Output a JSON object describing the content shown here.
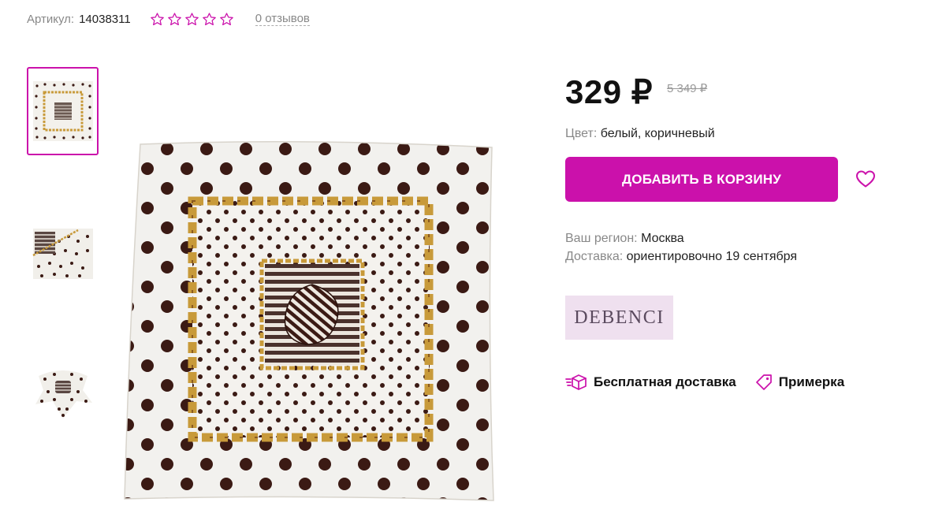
{
  "header": {
    "article_label": "Артикул:",
    "article_value": "14038311",
    "rating_stars": 0,
    "rating_max": 5,
    "reviews_link": "0 отзывов"
  },
  "gallery": {
    "thumbnails": [
      {
        "icon": "scarf-flat-thumbnail",
        "active": true
      },
      {
        "icon": "scarf-folded-thumbnail",
        "active": false
      },
      {
        "icon": "scarf-tied-thumbnail",
        "active": false
      }
    ],
    "main_image": "polka-dot-scarf-image"
  },
  "product": {
    "price": "329 ₽",
    "old_price": "5 349 ₽",
    "color_label": "Цвет:",
    "color_value": "белый, коричневый",
    "add_to_cart": "ДОБАВИТЬ В КОРЗИНУ",
    "favorite_icon": "heart-icon",
    "region_label": "Ваш регион:",
    "region_value": "Москва",
    "delivery_label": "Доставка:",
    "delivery_value": "ориентировочно 19 сентября",
    "brand": "DEBENCI"
  },
  "features": [
    {
      "icon": "delivery-box-icon",
      "label": "Бесплатная доставка"
    },
    {
      "icon": "tag-icon",
      "label": "Примерка"
    }
  ],
  "colors": {
    "accent": "#cb11ab",
    "brand_bg": "#efe0ef",
    "muted_text": "#888888",
    "dot": "#3b1a14",
    "chain_gold": "#c89a3a"
  }
}
